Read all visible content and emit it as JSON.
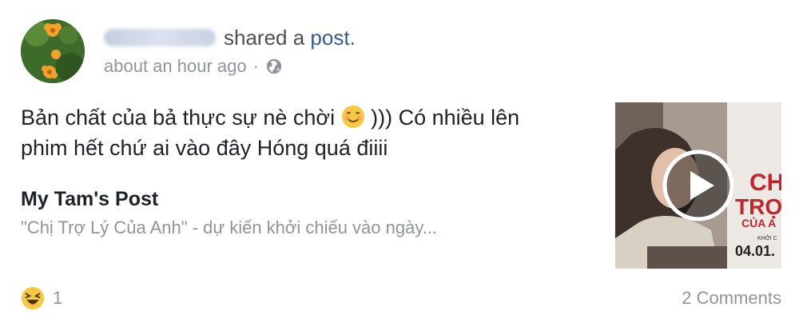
{
  "post": {
    "author_name": "Sang Diệp",
    "action_text": "shared a",
    "link_text": "post",
    "period": ".",
    "timestamp": "about an hour ago",
    "separator": "·",
    "privacy_icon": "globe-icon",
    "text_part1": "Bản chất của bả thực sự nè chời",
    "text_emoji": "smiling-face-icon",
    "text_part2": "))) Có nhiều lên phim hết chứ ai vào đây Hóng quá điiii"
  },
  "attachment": {
    "title": "My Tam's Post",
    "description": "\"Chị Trợ Lý Của Anh\" - dự kiến khởi chiếu vào ngày...",
    "thumbnail_text_1": "CH",
    "thumbnail_text_2": "TRỢ",
    "thumbnail_text_3": "CỦA A",
    "thumbnail_text_4": "KHỞI C",
    "thumbnail_text_5": "04.01.",
    "play_icon": "play-icon"
  },
  "footer": {
    "reaction_icon": "haha-icon",
    "reaction_count": "1",
    "comments_label": "2 Comments"
  },
  "colors": {
    "link": "#365899",
    "meta": "#90949c",
    "text": "#1d2129",
    "thumb_red": "#c0262c"
  }
}
